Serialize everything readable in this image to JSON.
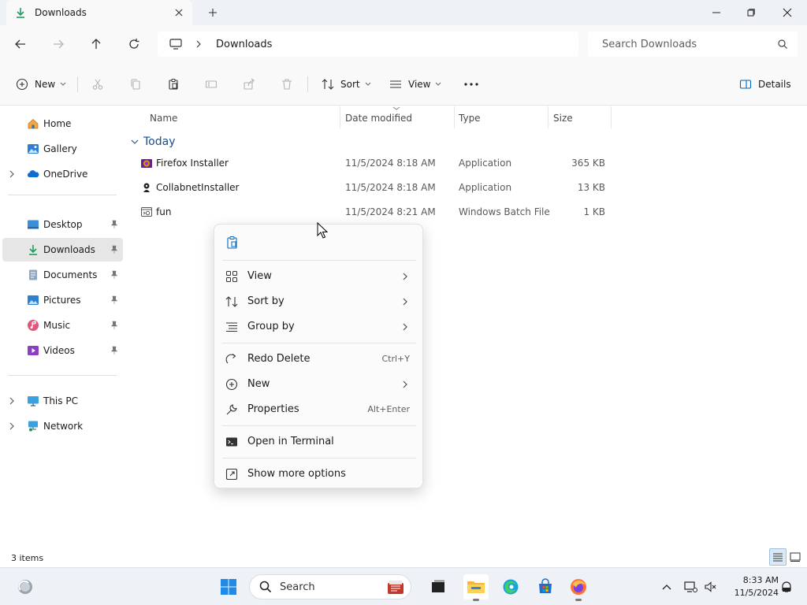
{
  "window": {
    "tab_title": "Downloads",
    "new_tab": "+"
  },
  "nav": {
    "breadcrumb": "Downloads",
    "search_placeholder": "Search Downloads"
  },
  "toolbar": {
    "new_label": "New",
    "sort_label": "Sort",
    "view_label": "View",
    "more_label": "⋯",
    "details_label": "Details"
  },
  "sidebar": {
    "items": [
      {
        "label": "Home",
        "icon": "home-icon"
      },
      {
        "label": "Gallery",
        "icon": "gallery-icon"
      },
      {
        "label": "OneDrive",
        "icon": "onedrive-icon"
      },
      {
        "label": "Desktop",
        "icon": "desktop-icon"
      },
      {
        "label": "Downloads",
        "icon": "downloads-icon"
      },
      {
        "label": "Documents",
        "icon": "documents-icon"
      },
      {
        "label": "Pictures",
        "icon": "pictures-icon"
      },
      {
        "label": "Music",
        "icon": "music-icon"
      },
      {
        "label": "Videos",
        "icon": "videos-icon"
      },
      {
        "label": "This PC",
        "icon": "this-pc-icon"
      },
      {
        "label": "Network",
        "icon": "network-icon"
      }
    ]
  },
  "columns": {
    "name": "Name",
    "date": "Date modified",
    "type": "Type",
    "size": "Size"
  },
  "group": {
    "label": "Today"
  },
  "files": [
    {
      "name": "Firefox Installer",
      "date": "11/5/2024 8:18 AM",
      "type": "Application",
      "size": "365 KB",
      "icon": "firefox-installer-icon"
    },
    {
      "name": "CollabnetInstaller",
      "date": "11/5/2024 8:18 AM",
      "type": "Application",
      "size": "13 KB",
      "icon": "app-installer-icon"
    },
    {
      "name": "fun",
      "date": "11/5/2024 8:21 AM",
      "type": "Windows Batch File",
      "size": "1 KB",
      "icon": "batch-file-icon"
    }
  ],
  "context_menu": {
    "items": [
      {
        "label": "View",
        "icon": "view-grid-icon",
        "submenu": true
      },
      {
        "label": "Sort by",
        "icon": "sort-icon",
        "submenu": true
      },
      {
        "label": "Group by",
        "icon": "group-by-icon",
        "submenu": true
      },
      {
        "label": "Redo Delete",
        "icon": "redo-icon",
        "shortcut": "Ctrl+Y"
      },
      {
        "label": "New",
        "icon": "new-icon",
        "submenu": true
      },
      {
        "label": "Properties",
        "icon": "wrench-icon",
        "shortcut": "Alt+Enter"
      },
      {
        "label": "Open in Terminal",
        "icon": "terminal-icon"
      },
      {
        "label": "Show more options",
        "icon": "more-options-icon"
      }
    ]
  },
  "status": {
    "count": "3 items"
  },
  "taskbar": {
    "search_placeholder": "Search",
    "time": "8:33 AM",
    "date": "11/5/2024"
  },
  "colors": {
    "accent": "#0067c0",
    "group_header": "#1a4f8b",
    "selected_bg": "#e6e6e6"
  }
}
